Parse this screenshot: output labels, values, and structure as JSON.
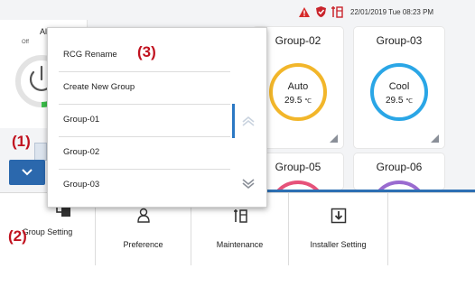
{
  "status_bar": {
    "datetime": "22/01/2019 Tue 08:23 PM",
    "icons": [
      "warning-triangle-icon",
      "shield-icon",
      "maintenance-icon"
    ],
    "warning_color": "#d62b2b"
  },
  "power_panel": {
    "title": "All",
    "state": "Off"
  },
  "groups": [
    {
      "name": "Group-02",
      "mode": "Auto",
      "temp": "29.5",
      "unit": "℃",
      "ring_color": "#f2b62a"
    },
    {
      "name": "Group-03",
      "mode": "Cool",
      "temp": "29.5",
      "unit": "℃",
      "ring_color": "#2aa6e6"
    },
    {
      "name": "Group-05",
      "ring_color": "#e6527a"
    },
    {
      "name": "Group-06",
      "ring_color": "#9a6bd0"
    }
  ],
  "dropdown_menu": {
    "items": [
      {
        "label": "RCG Rename"
      },
      {
        "label": "Create New Group"
      },
      {
        "label": "Group-01"
      },
      {
        "label": "Group-02"
      },
      {
        "label": "Group-03"
      }
    ],
    "accent_color": "#2b78c4"
  },
  "bottom_nav": {
    "items": [
      {
        "label": "Group Setting",
        "icon": "group-setting-icon"
      },
      {
        "label": "Preference",
        "icon": "person-icon"
      },
      {
        "label": "Maintenance",
        "icon": "maintenance-icon"
      },
      {
        "label": "Installer Setting",
        "icon": "download-box-icon"
      }
    ]
  },
  "callouts": {
    "c1": "(1)",
    "c2": "(2)",
    "c3": "(3)"
  }
}
